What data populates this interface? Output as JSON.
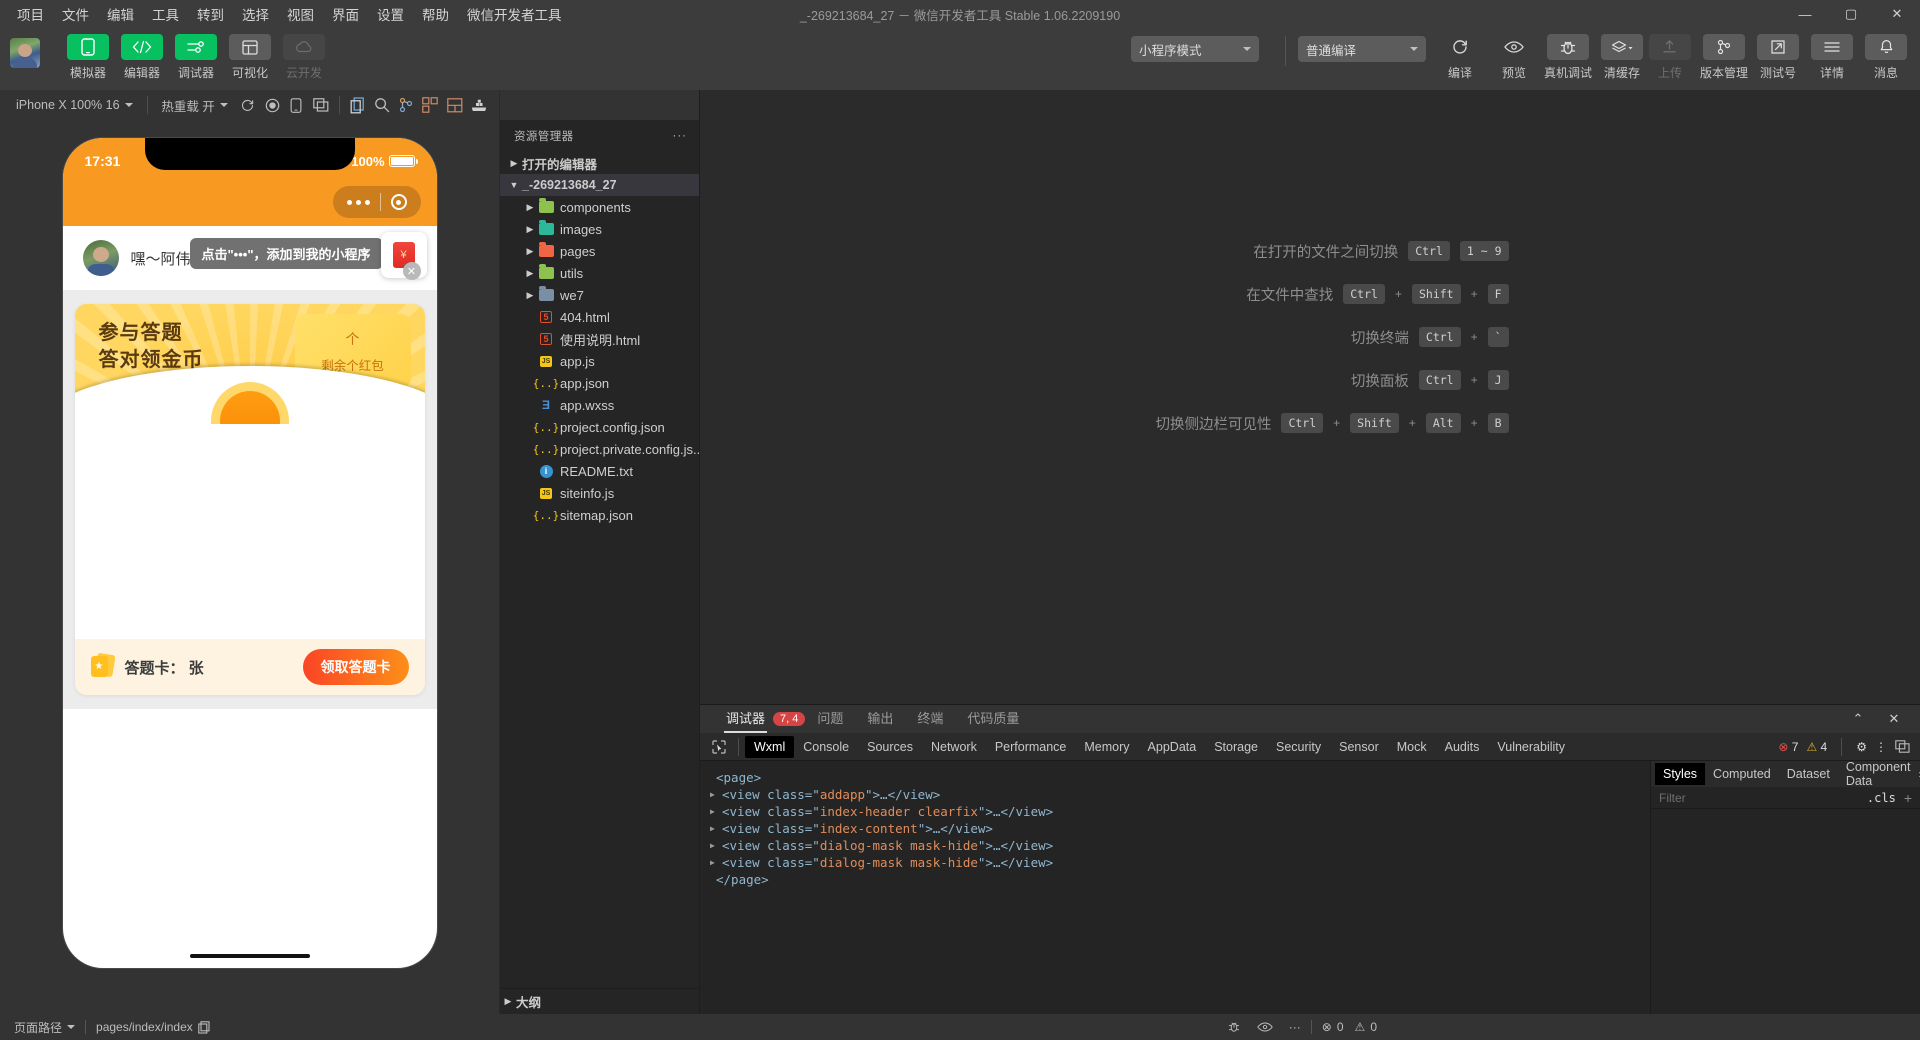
{
  "window": {
    "title": "_-269213684_27 － 微信开发者工具 Stable 1.06.2209190",
    "minimize": "—",
    "maximize": "▢",
    "close": "✕"
  },
  "menubar": {
    "items": [
      "项目",
      "文件",
      "编辑",
      "工具",
      "转到",
      "选择",
      "视图",
      "界面",
      "设置",
      "帮助",
      "微信开发者工具"
    ]
  },
  "toolbar": {
    "left_buttons": [
      {
        "label": "模拟器",
        "icon": "phone-icon",
        "state": "active"
      },
      {
        "label": "编辑器",
        "icon": "code-icon",
        "state": "active"
      },
      {
        "label": "调试器",
        "icon": "sliders-icon",
        "state": "active"
      },
      {
        "label": "可视化",
        "icon": "layout-icon",
        "state": "inactive"
      },
      {
        "label": "云开发",
        "icon": "cloud-icon",
        "state": "disabled"
      }
    ],
    "mode_select": "小程序模式",
    "compile_select": "普通编译",
    "action_buttons": [
      {
        "label": "编译",
        "icon": "refresh-icon"
      },
      {
        "label": "预览",
        "icon": "eye-icon"
      },
      {
        "label": "真机调试",
        "icon": "bug-icon"
      },
      {
        "label": "清缓存",
        "icon": "layers-icon"
      }
    ],
    "right_buttons": [
      {
        "label": "上传",
        "icon": "upload-icon",
        "state": "disabled"
      },
      {
        "label": "版本管理",
        "icon": "branch-icon",
        "state": "normal"
      },
      {
        "label": "测试号",
        "icon": "external-link-icon",
        "state": "normal"
      },
      {
        "label": "详情",
        "icon": "menu-icon",
        "state": "normal"
      },
      {
        "label": "消息",
        "icon": "bell-icon",
        "state": "normal"
      }
    ]
  },
  "simulator": {
    "device_label": "iPhone X 100% 16",
    "hotreload_label": "热重载 开",
    "icons": [
      "refresh-icon",
      "record-icon",
      "rotate-icon",
      "multiwindow-icon",
      "copy-icon",
      "search-icon",
      "branch-icon",
      "extensions-icon",
      "split-icon",
      "docker-icon"
    ],
    "phone": {
      "status_time": "17:31",
      "battery_percent": "100%",
      "nav_user": "嘿～阿伟",
      "tip": "点击\"•••\"，添加到我的小程序",
      "card": {
        "title_line1": "参与答题",
        "title_line2": "答对领金币",
        "count_unit": "个",
        "count_label": "剩余个红包",
        "ticket_label": "答题卡：  张",
        "claim_button": "领取答题卡"
      }
    }
  },
  "explorer": {
    "header": "资源管理器",
    "more": "···",
    "sections": [
      {
        "label": "打开的编辑器",
        "expanded": false
      },
      {
        "label": "_-269213684_27",
        "expanded": true
      }
    ],
    "tree": [
      {
        "label": "components",
        "type": "folder",
        "color": "#8fc14e",
        "depth": 1,
        "expandable": true
      },
      {
        "label": "images",
        "type": "folder",
        "color": "#2bb99a",
        "depth": 1,
        "expandable": true
      },
      {
        "label": "pages",
        "type": "folder",
        "color": "#f06543",
        "depth": 1,
        "expandable": true
      },
      {
        "label": "utils",
        "type": "folder",
        "color": "#8fc14e",
        "depth": 1,
        "expandable": true
      },
      {
        "label": "we7",
        "type": "folder",
        "color": "#7a8fa6",
        "depth": 1,
        "expandable": true
      },
      {
        "label": "404.html",
        "type": "html",
        "color": "#e44d26",
        "depth": 2,
        "expandable": false
      },
      {
        "label": "使用说明.html",
        "type": "html",
        "color": "#e44d26",
        "depth": 2,
        "expandable": false
      },
      {
        "label": "app.js",
        "type": "js",
        "color": "#f5c518",
        "depth": 2,
        "expandable": false
      },
      {
        "label": "app.json",
        "type": "json",
        "color": "#f5c518",
        "depth": 2,
        "expandable": false
      },
      {
        "label": "app.wxss",
        "type": "css",
        "color": "#4a90d9",
        "depth": 2,
        "expandable": false
      },
      {
        "label": "project.config.json",
        "type": "json",
        "color": "#f5c518",
        "depth": 2,
        "expandable": false
      },
      {
        "label": "project.private.config.js...",
        "type": "json",
        "color": "#f5c518",
        "depth": 2,
        "expandable": false
      },
      {
        "label": "README.txt",
        "type": "info",
        "color": "#3794d2",
        "depth": 2,
        "expandable": false
      },
      {
        "label": "siteinfo.js",
        "type": "js",
        "color": "#f5c518",
        "depth": 2,
        "expandable": false
      },
      {
        "label": "sitemap.json",
        "type": "json",
        "color": "#f5c518",
        "depth": 2,
        "expandable": false
      }
    ],
    "outline": "大纲"
  },
  "editor": {
    "shortcuts": [
      {
        "label": "在打开的文件之间切换",
        "keys": [
          "Ctrl",
          "1 ~ 9"
        ],
        "separators": [
          ""
        ]
      },
      {
        "label": "在文件中查找",
        "keys": [
          "Ctrl",
          "Shift",
          "F"
        ],
        "separators": [
          "+",
          "+"
        ]
      },
      {
        "label": "切换终端",
        "keys": [
          "Ctrl",
          "`"
        ],
        "separators": [
          "+"
        ]
      },
      {
        "label": "切换面板",
        "keys": [
          "Ctrl",
          "J"
        ],
        "separators": [
          "+"
        ]
      },
      {
        "label": "切换侧边栏可见性",
        "keys": [
          "Ctrl",
          "Shift",
          "Alt",
          "B"
        ],
        "separators": [
          "+",
          "+",
          "+"
        ]
      }
    ]
  },
  "devtools": {
    "panel_tabs": [
      {
        "label": "调试器",
        "active": true,
        "badge": "7, 4"
      },
      {
        "label": "问题",
        "active": false
      },
      {
        "label": "输出",
        "active": false
      },
      {
        "label": "终端",
        "active": false
      },
      {
        "label": "代码质量",
        "active": false
      }
    ],
    "inspector_tabs": [
      "Wxml",
      "Console",
      "Sources",
      "Network",
      "Performance",
      "Memory",
      "AppData",
      "Storage",
      "Security",
      "Sensor",
      "Mock",
      "Audits",
      "Vulnerability"
    ],
    "active_inspector_tab": "Wxml",
    "error_count": "7",
    "warning_count": "4",
    "wxml_lines": [
      {
        "indent": 0,
        "arrow": false,
        "open": "<page>",
        "cls": null,
        "close": null
      },
      {
        "indent": 1,
        "arrow": true,
        "open": "<view class=\"",
        "cls": "addapp",
        "close": "\">…</view>"
      },
      {
        "indent": 1,
        "arrow": true,
        "open": "<view class=\"",
        "cls": "index-header clearfix",
        "close": "\">…</view>"
      },
      {
        "indent": 1,
        "arrow": true,
        "open": "<view class=\"",
        "cls": "index-content",
        "close": "\">…</view>"
      },
      {
        "indent": 1,
        "arrow": true,
        "open": "<view class=\"",
        "cls": "dialog-mask mask-hide",
        "close": "\">…</view>"
      },
      {
        "indent": 1,
        "arrow": true,
        "open": "<view class=\"",
        "cls": "dialog-mask mask-hide",
        "close": "\">…</view>"
      },
      {
        "indent": 0,
        "arrow": false,
        "open": "</page>",
        "cls": null,
        "close": null
      }
    ],
    "styles_tabs": [
      "Styles",
      "Computed",
      "Dataset",
      "Component Data"
    ],
    "active_styles_tab": "Styles",
    "styles_more": "»",
    "filter_placeholder": "Filter",
    "cls_label": ".cls",
    "add_rule": "+"
  },
  "statusbar": {
    "page_path_label": "页面路径",
    "page_path_value": "pages/index/index",
    "copy_icon": "copy-icon",
    "icons": [
      "bug-icon",
      "eye-icon",
      "ellipsis-icon"
    ],
    "error_count": "0",
    "warning_count": "0"
  },
  "colors": {
    "accent_green": "#07c160",
    "orange": "#f89a22",
    "card_yellow": "#ffd34e",
    "claim_gradient_from": "#fa4525",
    "claim_gradient_to": "#fd8f19",
    "error_red": "#d64545"
  }
}
